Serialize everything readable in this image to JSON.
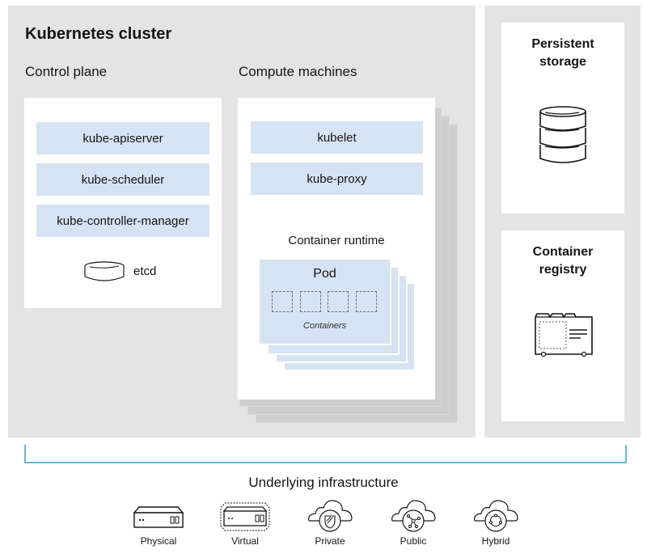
{
  "cluster": {
    "title": "Kubernetes cluster",
    "control_plane": {
      "heading": "Control plane",
      "components": [
        "kube-apiserver",
        "kube-scheduler",
        "kube-controller-manager"
      ],
      "datastore": "etcd"
    },
    "compute": {
      "heading": "Compute machines",
      "components": [
        "kubelet",
        "kube-proxy"
      ],
      "runtime_label": "Container runtime",
      "pod_label": "Pod",
      "containers_label": "Containers",
      "container_count": 4
    }
  },
  "side": {
    "storage": {
      "line1": "Persistent",
      "line2": "storage",
      "icon": "database-icon"
    },
    "registry": {
      "line1": "Container",
      "line2": "registry",
      "icon": "registry-icon"
    }
  },
  "infrastructure": {
    "title": "Underlying infrastructure",
    "items": [
      {
        "label": "Physical",
        "icon": "server-icon"
      },
      {
        "label": "Virtual",
        "icon": "virtual-server-icon"
      },
      {
        "label": "Private",
        "icon": "private-cloud-icon"
      },
      {
        "label": "Public",
        "icon": "public-cloud-icon"
      },
      {
        "label": "Hybrid",
        "icon": "hybrid-cloud-icon"
      }
    ]
  },
  "colors": {
    "panel": "#e4e4e4",
    "component": "#d6e3f3",
    "bracket": "#6fb3d6"
  }
}
